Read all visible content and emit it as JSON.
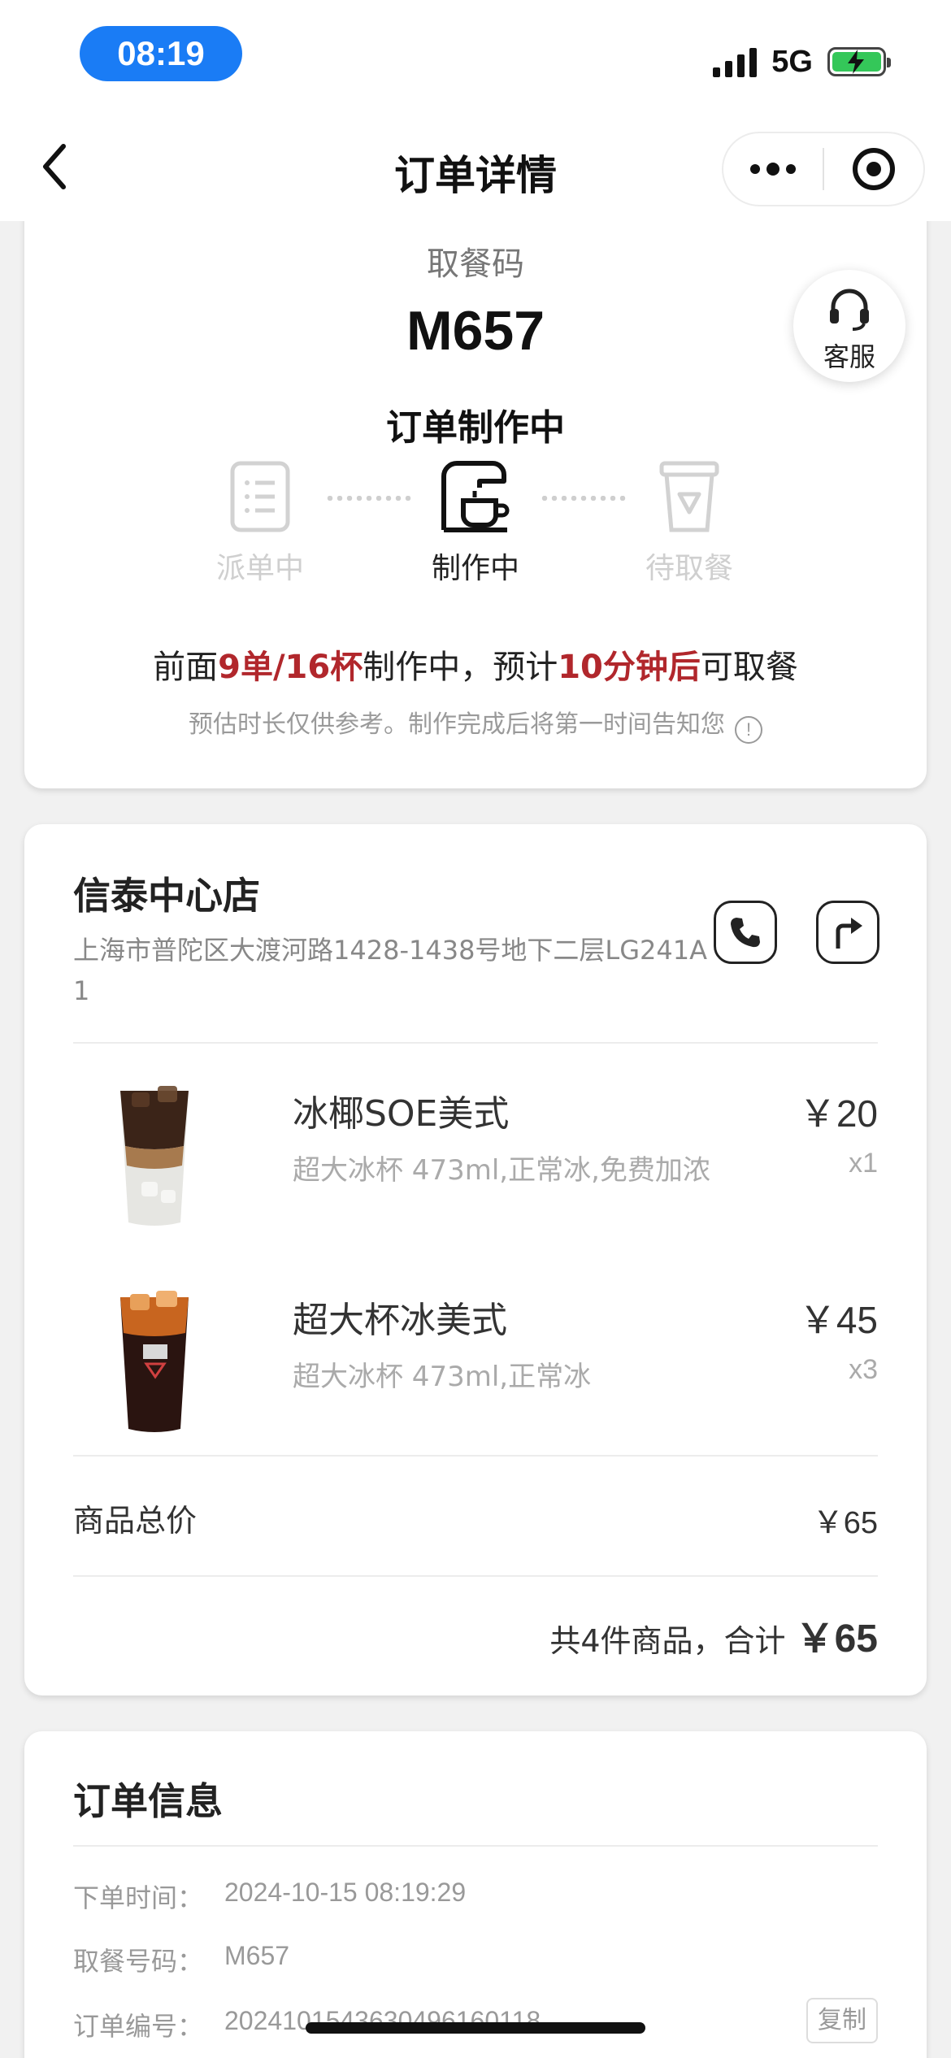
{
  "status_bar": {
    "time": "08:19",
    "network": "5G"
  },
  "nav": {
    "title": "订单详情"
  },
  "pickup": {
    "label": "取餐码",
    "code": "M657",
    "status": "订单制作中",
    "service_label": "客服",
    "steps": [
      {
        "label": "派单中",
        "icon": "clipboard-icon",
        "active": false
      },
      {
        "label": "制作中",
        "icon": "coffee-machine-icon",
        "active": true
      },
      {
        "label": "待取餐",
        "icon": "cup-icon",
        "active": false
      }
    ],
    "eta": {
      "prefix": "前面",
      "queue": "9单/16杯",
      "middle": "制作中，预计",
      "time": "10分钟后",
      "suffix": "可取餐"
    },
    "note": "预估时长仅供参考。制作完成后将第一时间告知您"
  },
  "store": {
    "name": "信泰中心店",
    "address": "上海市普陀区大渡河路1428-1438号地下二层LG241A1"
  },
  "items": [
    {
      "name": "冰椰SOE美式",
      "spec": "超大冰杯 473ml,正常冰,免费加浓",
      "price": "￥20",
      "qty": "x1"
    },
    {
      "name": "超大杯冰美式",
      "spec": "超大冰杯 473ml,正常冰",
      "price": "￥45",
      "qty": "x3"
    }
  ],
  "summary": {
    "subtotal_label": "商品总价",
    "subtotal_value": "￥65",
    "total_prefix": "共4件商品，合计",
    "total_value": "￥65"
  },
  "order_info": {
    "title": "订单信息",
    "rows": [
      {
        "key": "下单时间：",
        "value": "2024-10-15 08:19:29"
      },
      {
        "key": "取餐号码：",
        "value": "M657"
      },
      {
        "key": "订单编号：",
        "value": "20241015436304961601​18"
      }
    ],
    "copy_label": "复制"
  },
  "colors": {
    "accent_red": "#b1272c",
    "status_pill": "#1a7cf5",
    "battery": "#34c759"
  }
}
